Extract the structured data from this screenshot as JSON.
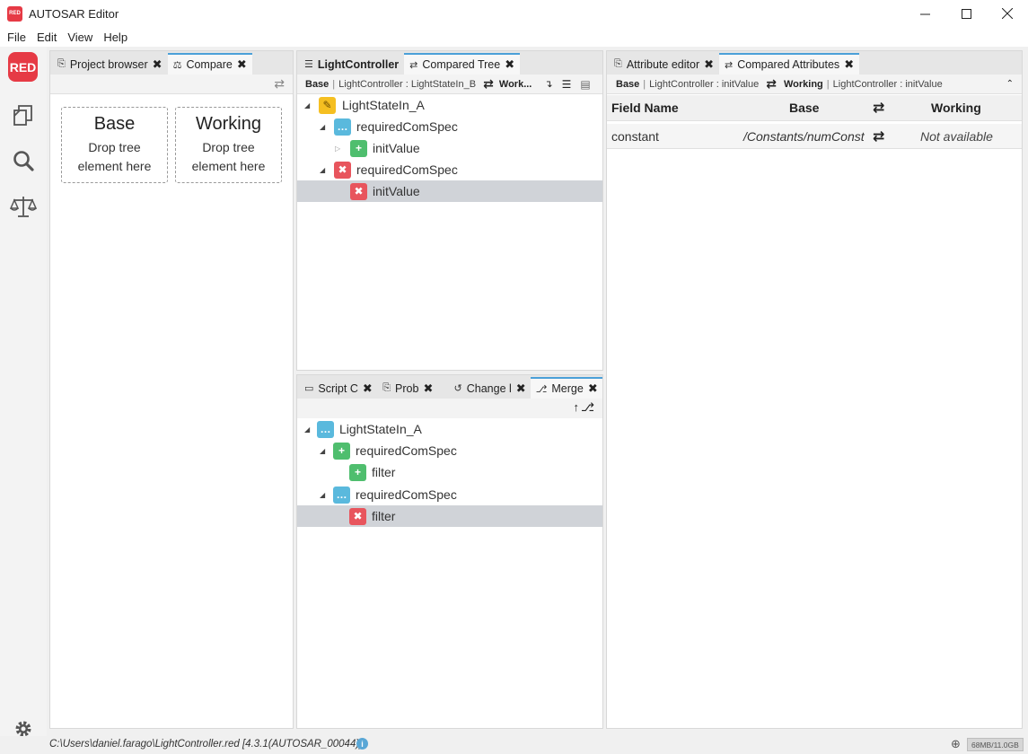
{
  "window": {
    "title": "AUTOSAR Editor",
    "logo_text": "RED"
  },
  "menu": [
    "File",
    "Edit",
    "View",
    "Help"
  ],
  "rail": {
    "logo_text": "RED",
    "icons": [
      "files-icon",
      "search-icon",
      "scale-icon"
    ],
    "bottom_icon": "gear-icon"
  },
  "left_pane": {
    "tabs": [
      {
        "label": "Project browser",
        "icon": "files-icon"
      },
      {
        "label": "Compare",
        "icon": "scale-icon",
        "active": true
      }
    ],
    "base": {
      "title": "Base",
      "hint_line1": "Drop tree",
      "hint_line2": "element here"
    },
    "working": {
      "title": "Working",
      "hint_line1": "Drop tree",
      "hint_line2": "element here"
    }
  },
  "tree_pane": {
    "tabs": [
      {
        "label": "LightController",
        "icon": "list-icon"
      },
      {
        "label": "Compared Tree",
        "icon": "swap-icon",
        "active": true
      }
    ],
    "subbar": {
      "base_label": "Base",
      "base_path": "LightController : LightStateIn_B",
      "working_label": "Work..."
    },
    "rows": [
      {
        "label": "LightStateIn_A",
        "kind": "modified"
      },
      {
        "label": "requiredComSpec",
        "kind": "changed"
      },
      {
        "label": "initValue",
        "kind": "added"
      },
      {
        "label": "requiredComSpec",
        "kind": "removed"
      },
      {
        "label": "initValue",
        "kind": "removed",
        "selected": true
      }
    ]
  },
  "attr_pane": {
    "tabs": [
      {
        "label": "Attribute editor",
        "icon": "files-icon"
      },
      {
        "label": "Compared Attributes",
        "icon": "swap-icon",
        "active": true
      }
    ],
    "subbar": {
      "base_label": "Base",
      "base_path": "LightController : initValue",
      "working_label": "Working",
      "working_path": "LightController : initValue"
    },
    "headers": {
      "field": "Field Name",
      "base": "Base",
      "working": "Working"
    },
    "row": {
      "field": "constant",
      "base": "/Constants/numConst",
      "working": "Not available"
    }
  },
  "merge_pane": {
    "tabs": [
      {
        "label": "Script C",
        "icon": "terminal-icon"
      },
      {
        "label": "Prob",
        "icon": "files-icon"
      },
      {
        "label": "Change l",
        "icon": "history-icon"
      },
      {
        "label": "Merge",
        "icon": "merge-icon",
        "active": true
      }
    ],
    "rows": [
      {
        "label": "LightStateIn_A",
        "kind": "changed"
      },
      {
        "label": "requiredComSpec",
        "kind": "added"
      },
      {
        "label": "filter",
        "kind": "added"
      },
      {
        "label": "requiredComSpec",
        "kind": "changed"
      },
      {
        "label": "filter",
        "kind": "removed",
        "selected": true
      }
    ]
  },
  "status": {
    "path": "C:\\Users\\daniel.farago\\LightController.red [4.3.1(AUTOSAR_00044)]",
    "memory": "68MB/11.0GB"
  },
  "colors": {
    "accent": "#4ba0d8",
    "brand": "#e63a45",
    "added": "#4fbe6e",
    "removed": "#e8555d",
    "changed": "#5ab9dd",
    "modified": "#f5bf21"
  }
}
